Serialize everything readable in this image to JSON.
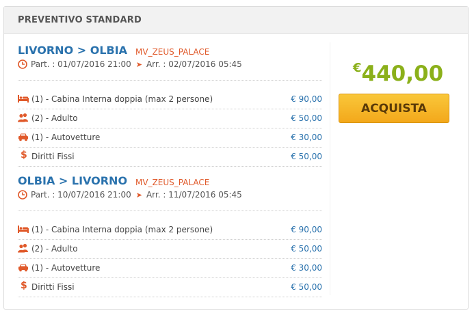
{
  "panel": {
    "title": "PREVENTIVO STANDARD"
  },
  "colors": {
    "route": "#2a72ad",
    "accent": "#e0592a",
    "price": "#2a72ad",
    "total": "#8bb01a",
    "button": "#f5b82a"
  },
  "routes": [
    {
      "name": "LIVORNO > OLBIA",
      "ship": "MV_ZEUS_PALACE",
      "departure": "Part. : 01/07/2016 21:00",
      "arrival": "Arr. : 02/07/2016 05:45",
      "lines": [
        {
          "icon": "bed-icon",
          "label": "(1) - Cabina Interna doppia (max 2 persone)",
          "price": "€ 90,00"
        },
        {
          "icon": "users-icon",
          "label": "(2) - Adulto",
          "price": "€ 50,00"
        },
        {
          "icon": "car-icon",
          "label": "(1) - Autovetture",
          "price": "€ 30,00"
        },
        {
          "icon": "dollar-icon",
          "label": "Diritti Fissi",
          "price": "€ 50,00"
        }
      ]
    },
    {
      "name": "OLBIA > LIVORNO",
      "ship": "MV_ZEUS_PALACE",
      "departure": "Part. : 10/07/2016 21:00",
      "arrival": "Arr. : 11/07/2016 05:45",
      "lines": [
        {
          "icon": "bed-icon",
          "label": "(1) - Cabina Interna doppia (max 2 persone)",
          "price": "€ 90,00"
        },
        {
          "icon": "users-icon",
          "label": "(2) - Adulto",
          "price": "€ 50,00"
        },
        {
          "icon": "car-icon",
          "label": "(1) - Autovetture",
          "price": "€ 30,00"
        },
        {
          "icon": "dollar-icon",
          "label": "Diritti Fissi",
          "price": "€ 50,00"
        }
      ]
    }
  ],
  "summary": {
    "currency": "€",
    "total": "440,00",
    "buy_label": "ACQUISTA"
  }
}
